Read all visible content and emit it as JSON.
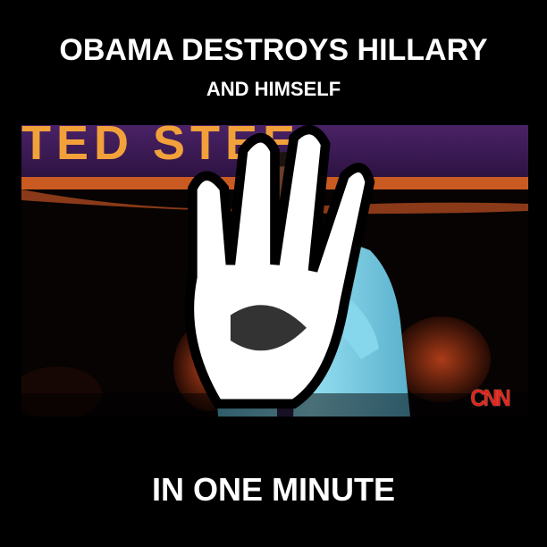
{
  "headline": "OBAMA DESTROYS HILLARY",
  "subheadline": "AND HIMSELF",
  "footer": "IN ONE MINUTE",
  "video": {
    "banner_text": "TED STEEL",
    "network_logo": "CNN",
    "overlay_icon": "hand-icon"
  },
  "colors": {
    "background": "#000000",
    "text": "#ffffff",
    "banner_orange": "#d9621f",
    "banner_purple": "#3a1a5a",
    "shirt_blue": "#7ed0e6",
    "cnn_red": "#e1251b"
  }
}
